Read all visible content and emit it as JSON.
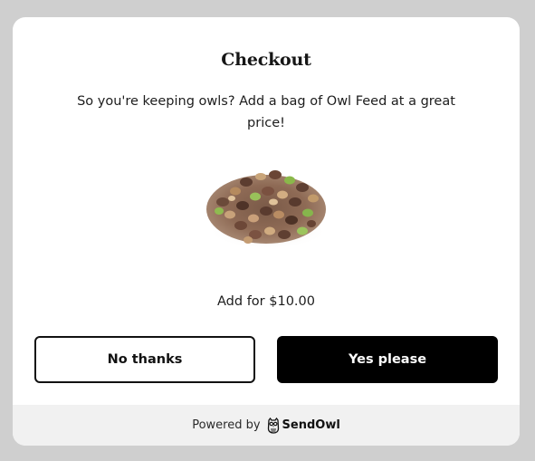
{
  "modal": {
    "title": "Checkout",
    "description": "So you're keeping owls? Add a bag of Owl Feed at a great price!",
    "price_text": "Add for $10.00",
    "product_image": "owl-feed-pellets-image"
  },
  "buttons": {
    "decline_label": "No thanks",
    "accept_label": "Yes please"
  },
  "footer": {
    "powered_by": "Powered by",
    "brand_name": "SendOwl",
    "brand_icon": "owl-logo-icon"
  },
  "colors": {
    "backdrop": "#cfcfcf",
    "modal_bg": "#ffffff",
    "accept_bg": "#000000",
    "footer_bg": "#f1f1f1"
  }
}
